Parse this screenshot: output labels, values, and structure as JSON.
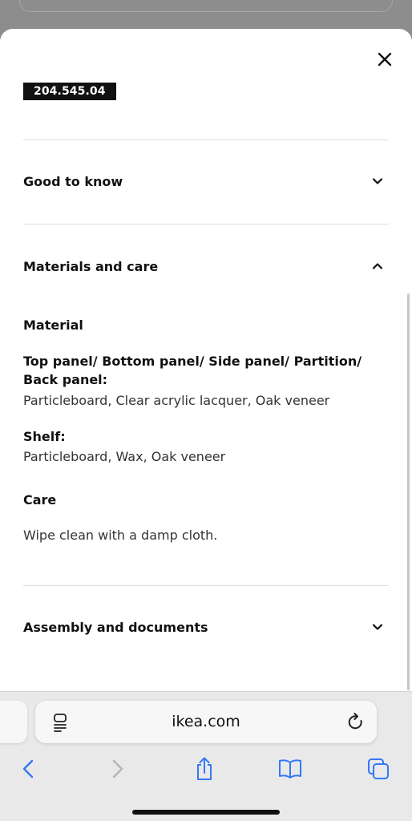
{
  "article_number": "204.545.04",
  "accordions": {
    "good_to_know": "Good to know",
    "materials_and_care": "Materials and care",
    "assembly": "Assembly and documents"
  },
  "materials": {
    "heading": "Material",
    "parts": [
      {
        "title": "Top panel/ Bottom panel/ Side panel/ Partition/ Back panel:",
        "value": "Particleboard, Clear acrylic lacquer, Oak veneer"
      },
      {
        "title": "Shelf:",
        "value": "Particleboard, Wax, Oak veneer"
      }
    ],
    "care_heading": "Care",
    "care_text": "Wipe clean with a damp cloth."
  },
  "browser": {
    "url": "ikea.com",
    "accent": "#3478f6"
  },
  "icons": {
    "close": "close-icon",
    "expand": "chevron-down-icon",
    "collapse": "chevron-up-icon",
    "reader": "reader-icon",
    "reload": "reload-icon",
    "back": "back-icon",
    "forward": "forward-icon",
    "share": "share-icon",
    "bookmarks": "bookmarks-icon",
    "tabs": "tabs-icon"
  }
}
